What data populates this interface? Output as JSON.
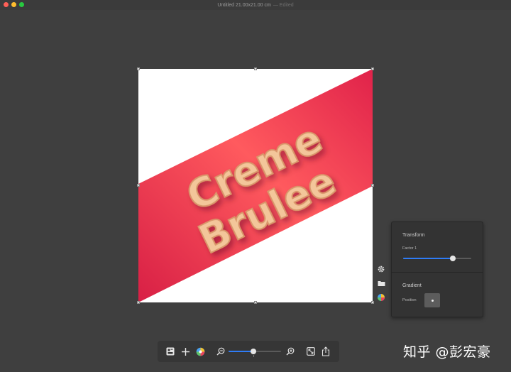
{
  "window": {
    "title": "Untitled 21.00x21.00 cm",
    "edited_label": "— Edited"
  },
  "artwork": {
    "line1": "Creme",
    "line2": "Brulee",
    "band_color": "#e8324f",
    "text_color": "#f3c69a"
  },
  "inspector": {
    "transform_title": "Transform",
    "factor_label": "Factor 1",
    "factor_value": 0.73,
    "gradient_title": "Gradient",
    "position_label": "Position"
  },
  "zoom": {
    "level": 0.47
  },
  "icons": {
    "side": [
      "gear-icon",
      "folder-icon",
      "color-wheel-icon"
    ],
    "toolbar": [
      "layers-icon",
      "add-icon",
      "color-wheel-icon",
      "zoom-out-icon",
      "zoom-in-icon",
      "fit-icon",
      "share-icon"
    ]
  },
  "watermark": "知乎 @彭宏豪"
}
